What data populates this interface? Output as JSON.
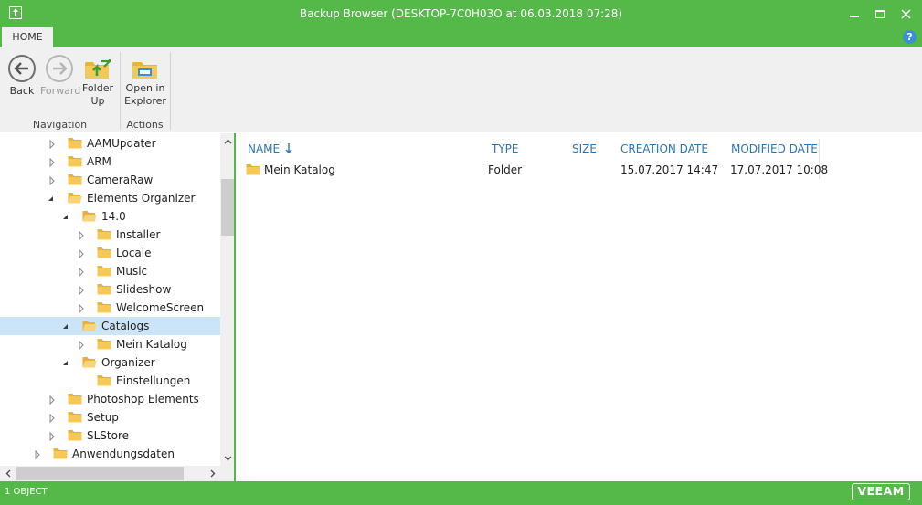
{
  "window": {
    "title": "Backup Browser (DESKTOP-7C0H03O at 06.03.2018 07:28)",
    "help_label": "?"
  },
  "ribbon": {
    "tab": "HOME",
    "groups": [
      {
        "label": "Navigation"
      },
      {
        "label": "Actions"
      }
    ],
    "buttons": {
      "back": {
        "line1": "Back",
        "line2": ""
      },
      "forward": {
        "line1": "Forward",
        "line2": ""
      },
      "folder_up": {
        "line1": "Folder",
        "line2": "Up"
      },
      "open_in_explorer": {
        "line1": "Open in",
        "line2": "Explorer"
      }
    }
  },
  "tree": {
    "items": [
      {
        "label": "AAMUpdater"
      },
      {
        "label": "ARM"
      },
      {
        "label": "CameraRaw"
      },
      {
        "label": "Elements Organizer"
      },
      {
        "label": "14.0"
      },
      {
        "label": "Installer"
      },
      {
        "label": "Locale"
      },
      {
        "label": "Music"
      },
      {
        "label": "Slideshow"
      },
      {
        "label": "WelcomeScreen"
      },
      {
        "label": "Catalogs"
      },
      {
        "label": "Mein Katalog"
      },
      {
        "label": "Organizer"
      },
      {
        "label": "Einstellungen"
      },
      {
        "label": "Photoshop Elements"
      },
      {
        "label": "Setup"
      },
      {
        "label": "SLStore"
      },
      {
        "label": "Anwendungsdaten"
      }
    ],
    "selected": "Catalogs"
  },
  "list": {
    "columns": {
      "name": "NAME",
      "type": "TYPE",
      "size": "SIZE",
      "created": "CREATION DATE",
      "modified": "MODIFIED DATE"
    },
    "sort_column": "NAME",
    "rows": [
      {
        "name": "Mein Katalog",
        "type": "Folder",
        "size": "",
        "created": "15.07.2017 14:47",
        "modified": "17.07.2017 10:08"
      }
    ]
  },
  "status": {
    "count": "1 OBJECT",
    "logo": "VEEAM"
  },
  "colors": {
    "brand": "#54b948",
    "header_text": "#2e74b5",
    "selection": "#cce4f7",
    "folder": "#f5c85a"
  }
}
